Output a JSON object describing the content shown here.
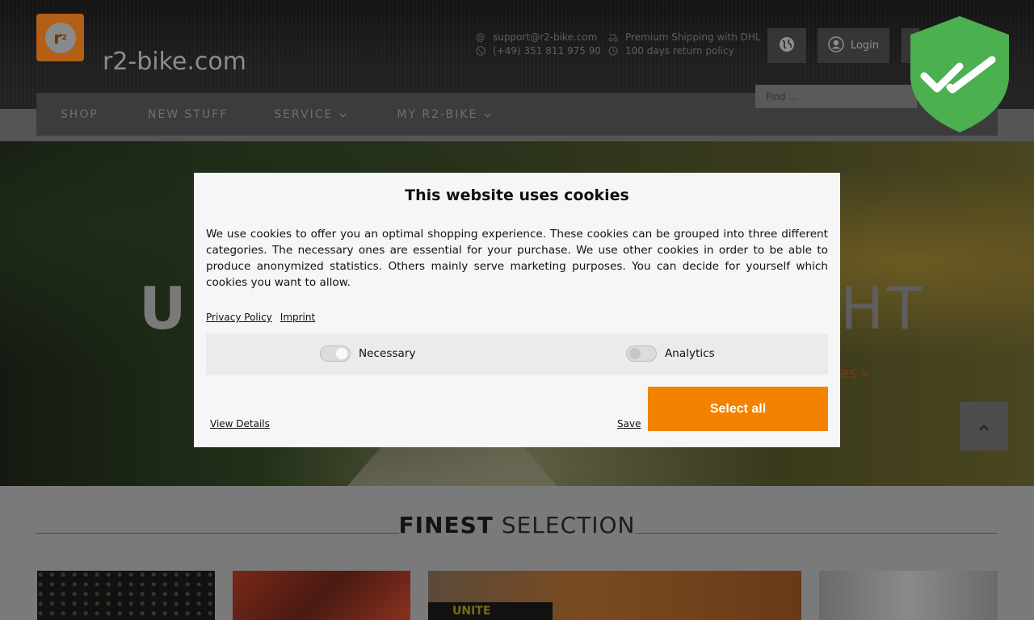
{
  "header": {
    "logo_text": "r",
    "logo_sup": "2",
    "site_name": "r2-bike.com",
    "contact": {
      "email": "support@r2-bike.com",
      "phone": "(+49) 351 811 975 90",
      "shipping": "Premium Shipping with DHL",
      "returns": "100 days return policy"
    },
    "login_label": "Login",
    "search_placeholder": "Find ..."
  },
  "nav": {
    "items": [
      {
        "label": "SHOP"
      },
      {
        "label": "NEW STUFF"
      },
      {
        "label": "SERVICE"
      },
      {
        "label": "MY R2-BIKE"
      }
    ]
  },
  "hero": {
    "title_left": "U",
    "title_right": "HT",
    "link_fragment": "es »"
  },
  "section": {
    "title_bold": "FINEST",
    "title_rest": "SELECTION"
  },
  "tiles": {
    "brand_fragment": "UNITE"
  },
  "cookie": {
    "title": "This website uses cookies",
    "body": "We use cookies to offer you an optimal shopping experience. These cookies can be grouped into three different categories. The necessary ones are essential for your purchase. We use other cookies in order to be able to produce anonymized statistics. Others mainly serve marketing purposes. You can decide for yourself which cookies you want to allow.",
    "privacy_label": "Privacy Policy",
    "imprint_label": "Imprint",
    "necessary_label": "Necessary",
    "necessary_on": true,
    "analytics_label": "Analytics",
    "analytics_on": false,
    "view_details_label": "View Details",
    "save_label": "Save",
    "select_all_label": "Select all"
  },
  "colors": {
    "accent": "#f38200",
    "shield_green": "#4caf50"
  },
  "icons": [
    "at-icon",
    "phone-icon",
    "truck-icon",
    "clock-icon",
    "globe-icon",
    "user-icon",
    "chevron-down-icon",
    "chevron-up-icon",
    "shield-check-icon"
  ]
}
